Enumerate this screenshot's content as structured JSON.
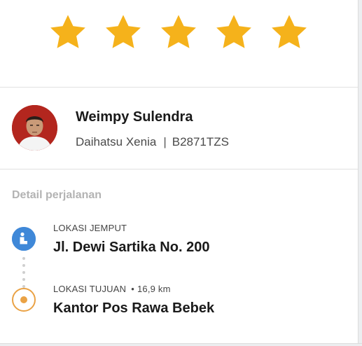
{
  "rating": {
    "value": 5,
    "max": 5,
    "star_color": "#F5B21B",
    "stars": [
      "star-icon",
      "star-icon",
      "star-icon",
      "star-icon",
      "star-icon"
    ]
  },
  "driver": {
    "name": "Weimpy Sulendra",
    "vehicle": "Daihatsu Xenia",
    "separator": "|",
    "plate": "B2871TZS",
    "avatar_icon": "driver-photo"
  },
  "trip": {
    "section_title": "Detail perjalanan",
    "pickup": {
      "label": "LOKASI JEMPUT",
      "address": "Jl. Dewi Sartika No. 200",
      "icon": "pickup-pin-icon",
      "color": "#3F88D8"
    },
    "destination": {
      "label": "LOKASI TUJUAN",
      "distance_separator": "•",
      "distance": "16,9 km",
      "address": "Kantor Pos Rawa Bebek",
      "icon": "destination-target-icon",
      "color": "#EAA245"
    }
  }
}
